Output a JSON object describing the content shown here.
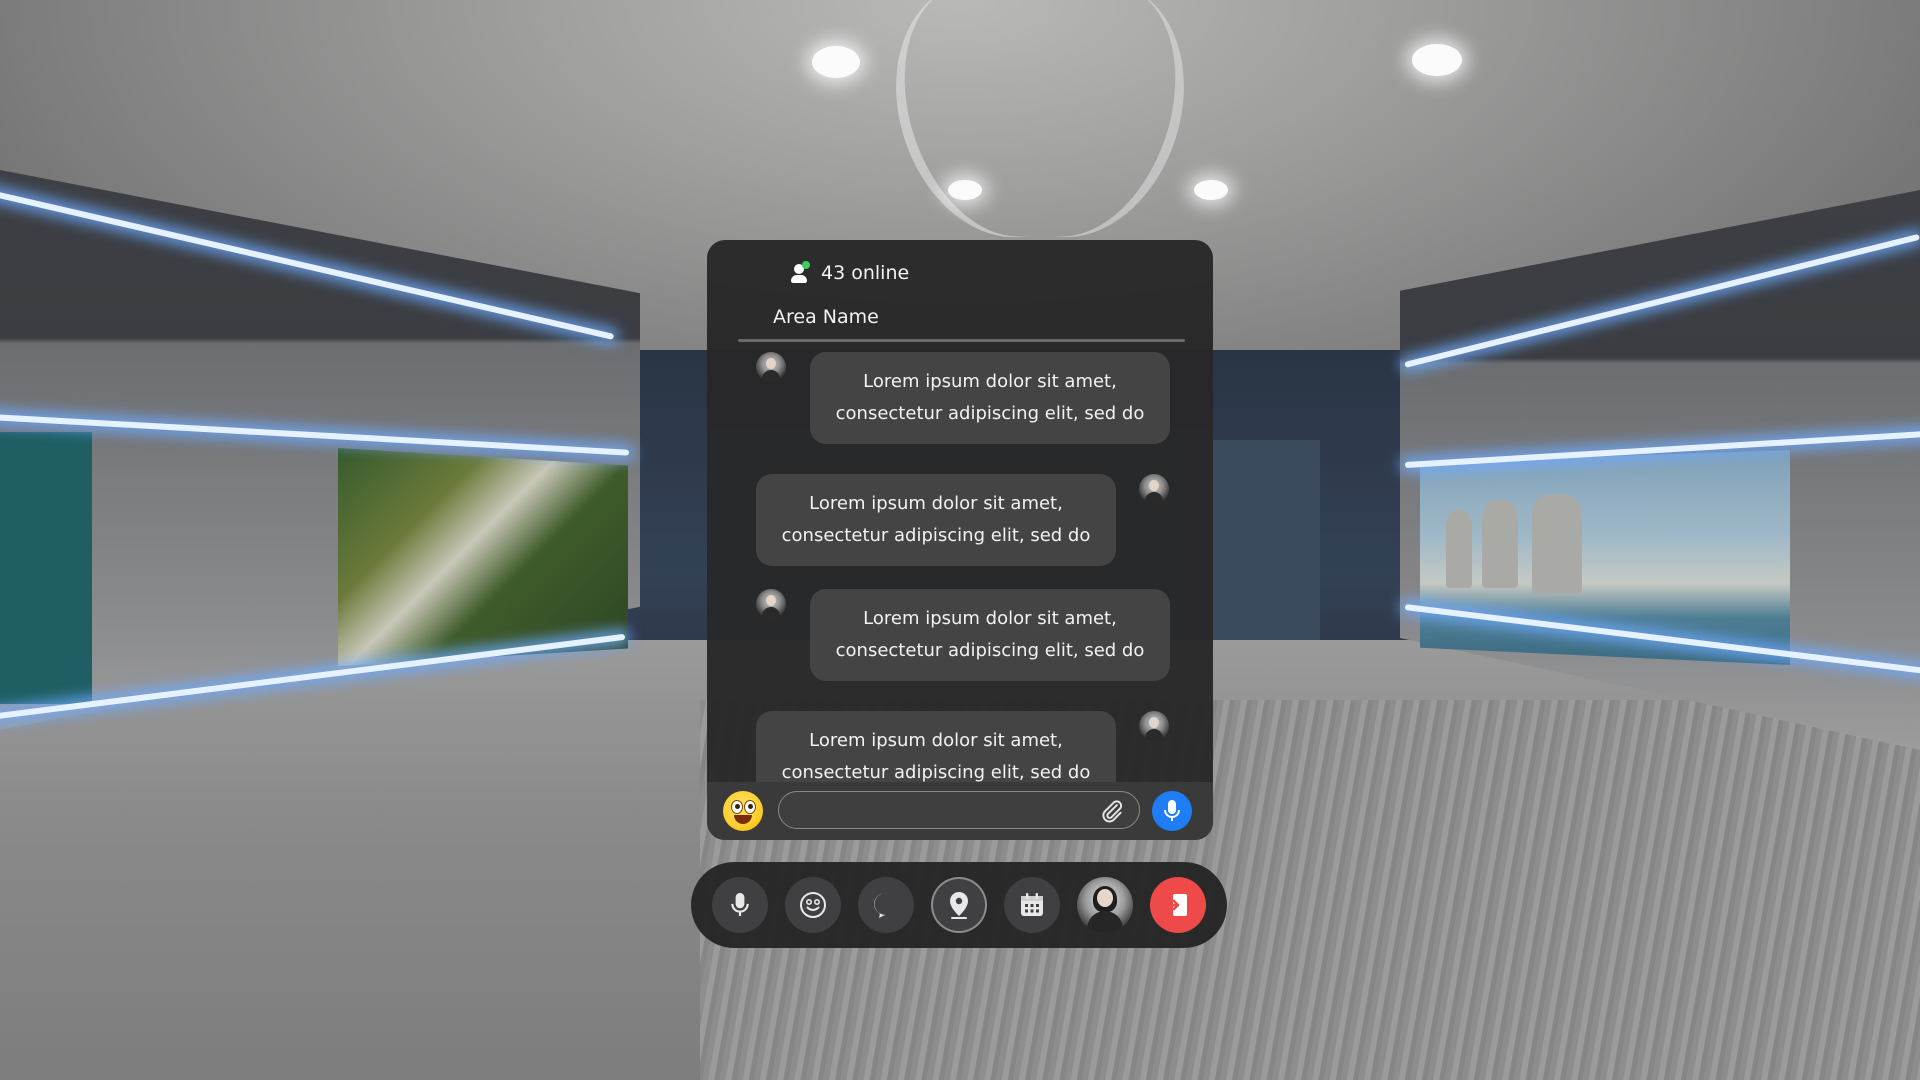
{
  "chat": {
    "online_count_text": "43 online",
    "area_name": "Area Name",
    "messages": [
      {
        "direction": "in",
        "text": "Lorem ipsum dolor sit amet, consectetur adipiscing elit, sed do"
      },
      {
        "direction": "out",
        "text": "Lorem ipsum dolor sit amet, consectetur adipiscing elit, sed do"
      },
      {
        "direction": "in",
        "text": "Lorem ipsum dolor sit amet, consectetur adipiscing elit, sed do"
      },
      {
        "direction": "out",
        "text": "Lorem ipsum dolor sit amet, consectetur adipiscing elit, sed do"
      }
    ],
    "composer": {
      "input_value": "",
      "input_placeholder": "",
      "emoji_icon": "emoji-face-icon",
      "attach_icon": "paperclip-icon",
      "mic_icon": "microphone-icon"
    }
  },
  "toolbar": {
    "buttons": [
      {
        "name": "microphone",
        "icon": "microphone-icon"
      },
      {
        "name": "emoji",
        "icon": "smiley-icon"
      },
      {
        "name": "chat",
        "icon": "chat-bubble-icon"
      },
      {
        "name": "location",
        "icon": "map-pin-icon",
        "active": true
      },
      {
        "name": "calendar",
        "icon": "calendar-icon"
      },
      {
        "name": "profile",
        "icon": "user-avatar"
      },
      {
        "name": "exit",
        "icon": "exit-door-icon"
      }
    ]
  },
  "colors": {
    "panel_bg": "#282829",
    "bubble_bg": "#444445",
    "online_dot": "#3ccf5e",
    "mic_blue": "#1f7ef5",
    "exit_red": "#ef4a4a",
    "neon_blue": "#6eaaff"
  }
}
